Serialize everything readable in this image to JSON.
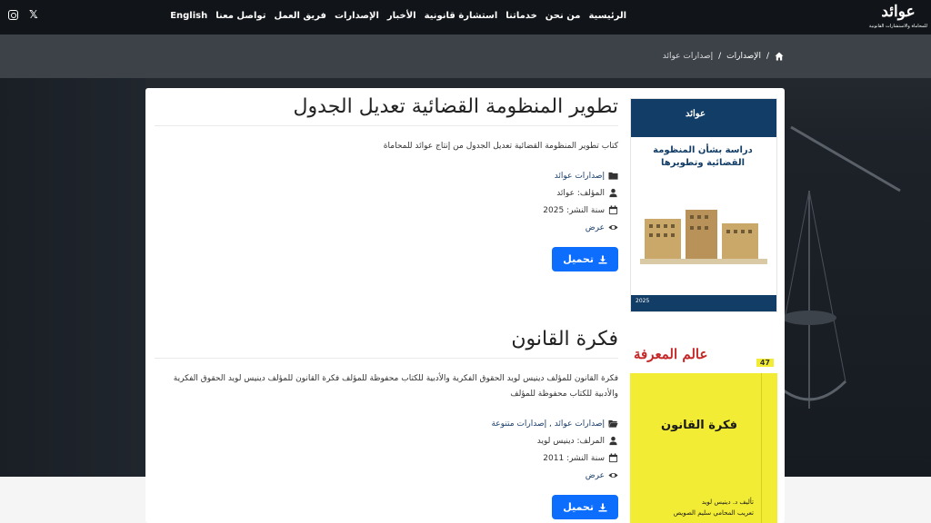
{
  "header": {
    "logo_text": "عوائد",
    "logo_sub": "للمحاماة والاستشارات القانونية",
    "nav": [
      {
        "label": "الرئيسية"
      },
      {
        "label": "من نحن"
      },
      {
        "label": "خدماتنا"
      },
      {
        "label": "استشارة قانونية"
      },
      {
        "label": "الأخبار"
      },
      {
        "label": "الإصدارات"
      },
      {
        "label": "فريق العمل"
      },
      {
        "label": "تواصل معنا"
      },
      {
        "label": "English"
      }
    ],
    "social_icons": [
      "instagram-icon",
      "x-icon"
    ]
  },
  "breadcrumb": {
    "home_icon": "home-icon",
    "items": [
      "الإصدارات",
      "إصدارات عوائد"
    ]
  },
  "publications": [
    {
      "title": "تطوير المنظومة القضائية تعديل الجدول",
      "description": "كتاب تطوير المنظومة القضائية تعديل الجدول من إنتاج عوائد للمحاماة",
      "category": "إصدارات عوائد",
      "author": "المؤلف: عوائد",
      "year": "سنة النشر: 2025",
      "view": "عرض",
      "download": "تحميل",
      "cover": {
        "brand": "عوائد",
        "title": "دراسة بشأن المنظومة القضائية وتطويرها",
        "year": "2025"
      }
    },
    {
      "title": "فكرة القانون",
      "description": "فكرة القانون للمؤلف دينيس لويد الحقوق الفكرية والأدبية للكتاب محفوظة للمؤلف فكرة القانون للمؤلف دينيس لويد الحقوق الفكرية والأدبية للكتاب محفوظة للمؤلف",
      "category": "إصدارات عوائد , إصدارات متنوعة",
      "author": "المرلف: دينيس لويد",
      "year": "سنة النشر: 2011",
      "view": "عرض",
      "download": "تحميل",
      "cover": {
        "series": "عالم المعرفة",
        "number": "47",
        "title": "فكرة القانون",
        "author_line": "تأليف د. دينيس لويد",
        "translator_line": "تعريب المحامي سليم الصويص"
      }
    }
  ],
  "colors": {
    "header_bg": "#111418",
    "breadcrumb_bg": "#3d4248",
    "primary_button": "#0d6efd",
    "link": "#1b3f6b",
    "cover1_blue": "#123d66",
    "cover2_yellow": "#f3ec35"
  }
}
